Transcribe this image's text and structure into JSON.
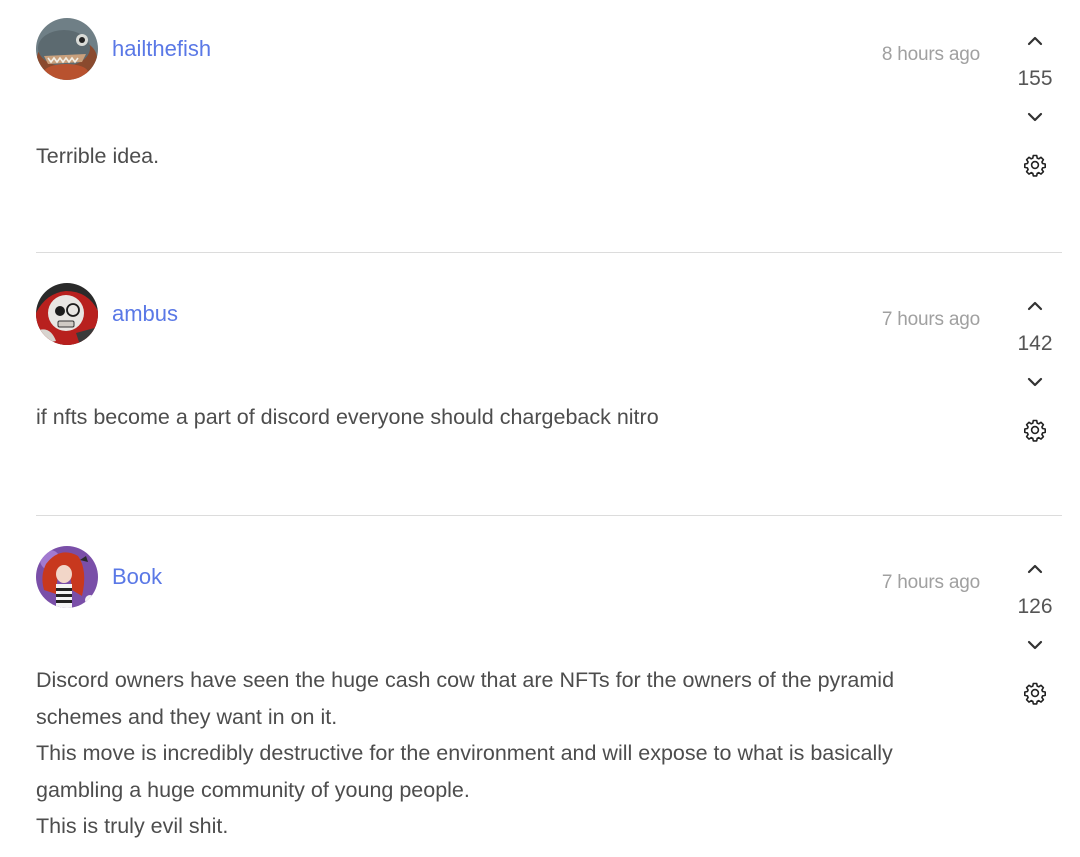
{
  "comments": [
    {
      "username": "hailthefish",
      "timestamp": "8 hours ago",
      "score": "155",
      "avatar_icon": "fish-avatar",
      "body": "Terrible idea."
    },
    {
      "username": "ambus",
      "timestamp": "7 hours ago",
      "score": "142",
      "avatar_icon": "skull-character-avatar",
      "body": "if nfts become a part of discord everyone should chargeback nitro"
    },
    {
      "username": "Book",
      "timestamp": "7 hours ago",
      "score": "126",
      "avatar_icon": "red-haired-girl-avatar",
      "body": "Discord owners have seen the huge cash cow that are NFTs for the owners of the pyramid schemes and they want in on it.\nThis move is incredibly destructive for the environment and will expose to what is basically gambling a huge community of young people.\nThis is truly evil shit."
    }
  ],
  "colors": {
    "username": "#5a78e6",
    "timestamp": "#a0a0a0",
    "divider": "#dcdcdc"
  }
}
